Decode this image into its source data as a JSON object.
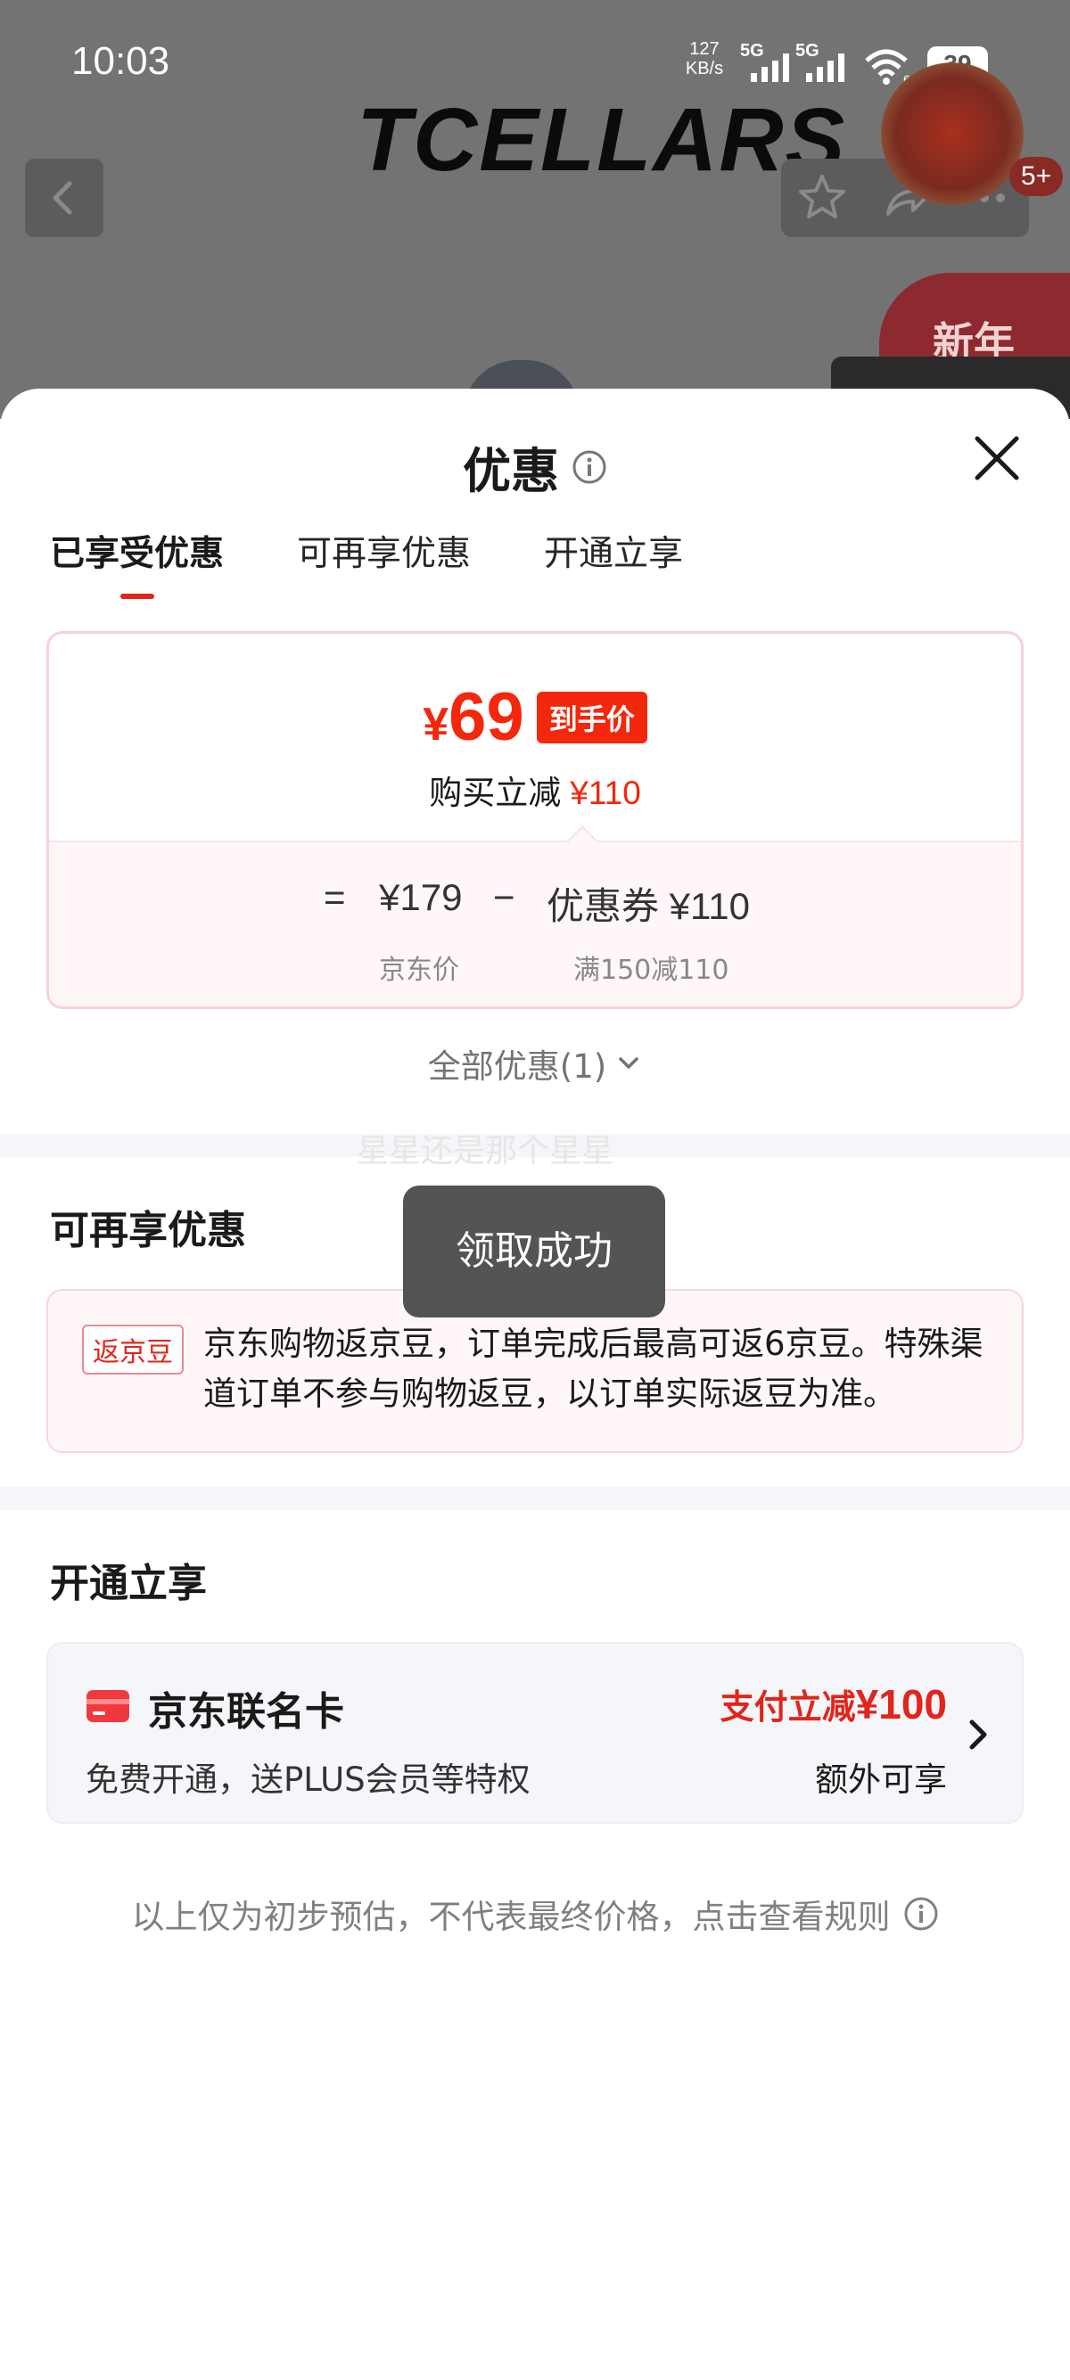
{
  "status_bar": {
    "time": "10:03",
    "net_speed_value": "127",
    "net_speed_unit": "KB/s",
    "signal1_label": "5G",
    "signal2_label": "5G",
    "wifi_badge": "6",
    "battery": "39"
  },
  "background": {
    "brand": "TCELLARS",
    "badge_count": "5+",
    "promo_label": "新年"
  },
  "sheet": {
    "title": "优惠",
    "tabs": [
      {
        "label": "已享受优惠",
        "active": true
      },
      {
        "label": "可再享优惠",
        "active": false
      },
      {
        "label": "开通立享",
        "active": false
      }
    ]
  },
  "calc": {
    "final_currency": "¥",
    "final_price": "69",
    "final_tag": "到手价",
    "reduce_label": "购买立减",
    "reduce_amount": "¥110",
    "equals": "=",
    "jd_price": "¥179",
    "minus": "−",
    "coupon_text": "优惠券 ¥110",
    "jd_price_label": "京东价",
    "coupon_rule": "满150减110"
  },
  "all_deals": "全部优惠(1)",
  "watermark": "星星还是那个星星",
  "more_section": {
    "title": "可再享优惠",
    "bean_tag": "返京豆",
    "bean_text": "京东购物返京豆，订单完成后最高可返6京豆。特殊渠道订单不参与购物返豆，以订单实际返豆为准。"
  },
  "open_section": {
    "title": "开通立享",
    "card_name": "京东联名卡",
    "card_desc": "免费开通，送PLUS会员等特权",
    "promo_prefix": "支付立减",
    "promo_amount": "¥100",
    "promo_extra": "额外可享"
  },
  "footnote": "以上仅为初步预估，不代表最终价格，点击查看规则",
  "toast": "领取成功",
  "colors": {
    "accent_red": "#f2270c",
    "tag_red": "#e1251b",
    "overlay": "#737373"
  }
}
